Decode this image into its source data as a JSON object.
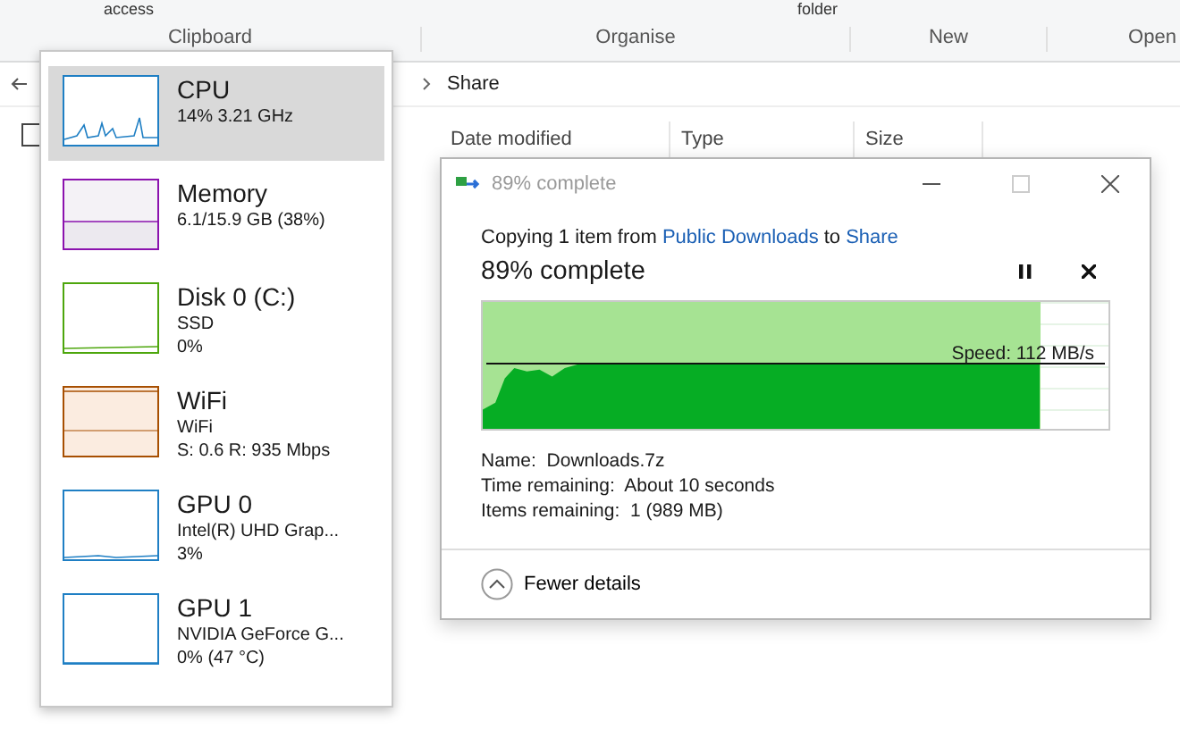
{
  "ribbon": {
    "top_texts": [
      "access",
      "folder"
    ],
    "groups": [
      "Clipboard",
      "Organise",
      "New",
      "Open"
    ]
  },
  "address_bar": {
    "crumb": "Share"
  },
  "file_list": {
    "select_all": {
      "checked": false
    },
    "columns": [
      "Date modified",
      "Type",
      "Size"
    ]
  },
  "performance_panel": {
    "items": [
      {
        "kind": "cpu",
        "name": "CPU",
        "lines": [
          "14%  3.21 GHz"
        ],
        "color": "#1f7fc4",
        "selected": true
      },
      {
        "kind": "memory",
        "name": "Memory",
        "lines": [
          "6.1/15.9 GB (38%)"
        ],
        "color": "#8b12ae",
        "selected": false
      },
      {
        "kind": "disk",
        "name": "Disk 0 (C:)",
        "lines": [
          "SSD",
          "0%"
        ],
        "color": "#4da60c",
        "selected": false
      },
      {
        "kind": "wifi",
        "name": "WiFi",
        "lines": [
          "WiFi",
          "S: 0.6 R: 935 Mbps"
        ],
        "color": "#a74f01",
        "selected": false
      },
      {
        "kind": "gpu",
        "name": "GPU 0",
        "lines": [
          "Intel(R) UHD Grap...",
          "3%"
        ],
        "color": "#1f7fc4",
        "selected": false
      },
      {
        "kind": "idle",
        "name": "GPU 1",
        "lines": [
          "NVIDIA GeForce G...",
          "0%  (47 °C)"
        ],
        "color": "#1f7fc4",
        "selected": false
      }
    ]
  },
  "copy_dialog": {
    "title": "89% complete",
    "message": {
      "prefix": "Copying 1 item from",
      "source": "Public Downloads",
      "middle": "to",
      "target": "Share"
    },
    "heading": "89% complete",
    "progress": {
      "level": 0.89,
      "speed": "Speed: 112 MB/s"
    },
    "details": [
      {
        "label": "Name:",
        "value": "Downloads.7z"
      },
      {
        "label": "Time remaining:",
        "value": "About 10 seconds"
      },
      {
        "label": "Items remaining:",
        "value": "1 (989 MB)"
      }
    ],
    "toggle": "Fewer details"
  }
}
